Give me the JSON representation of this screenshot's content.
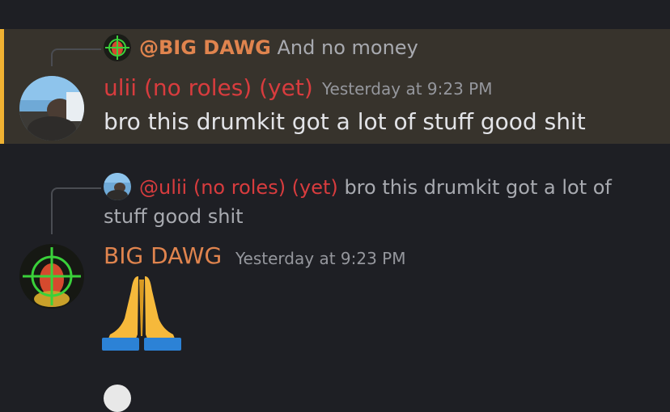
{
  "messages": [
    {
      "reply": {
        "mention": "@BIG DAWG",
        "text": "And no money"
      },
      "author": "ulii (no roles) (yet)",
      "timestamp": "Yesterday at 9:23 PM",
      "content": "bro this drumkit got a lot of stuff good  shit",
      "highlighted": true
    },
    {
      "reply": {
        "mention": "@ulii (no roles) (yet)",
        "text": "bro this drumkit got a lot of stuff good  shit"
      },
      "author": "BIG DAWG",
      "timestamp": "Yesterday at 9:23 PM",
      "content_emoji": "folded-hands"
    }
  ],
  "colors": {
    "background": "#1e1f24",
    "highlight_background": "#37332c",
    "highlight_bar": "#f0b232",
    "author_red": "#d83c3e",
    "author_orange": "#e0844e"
  }
}
